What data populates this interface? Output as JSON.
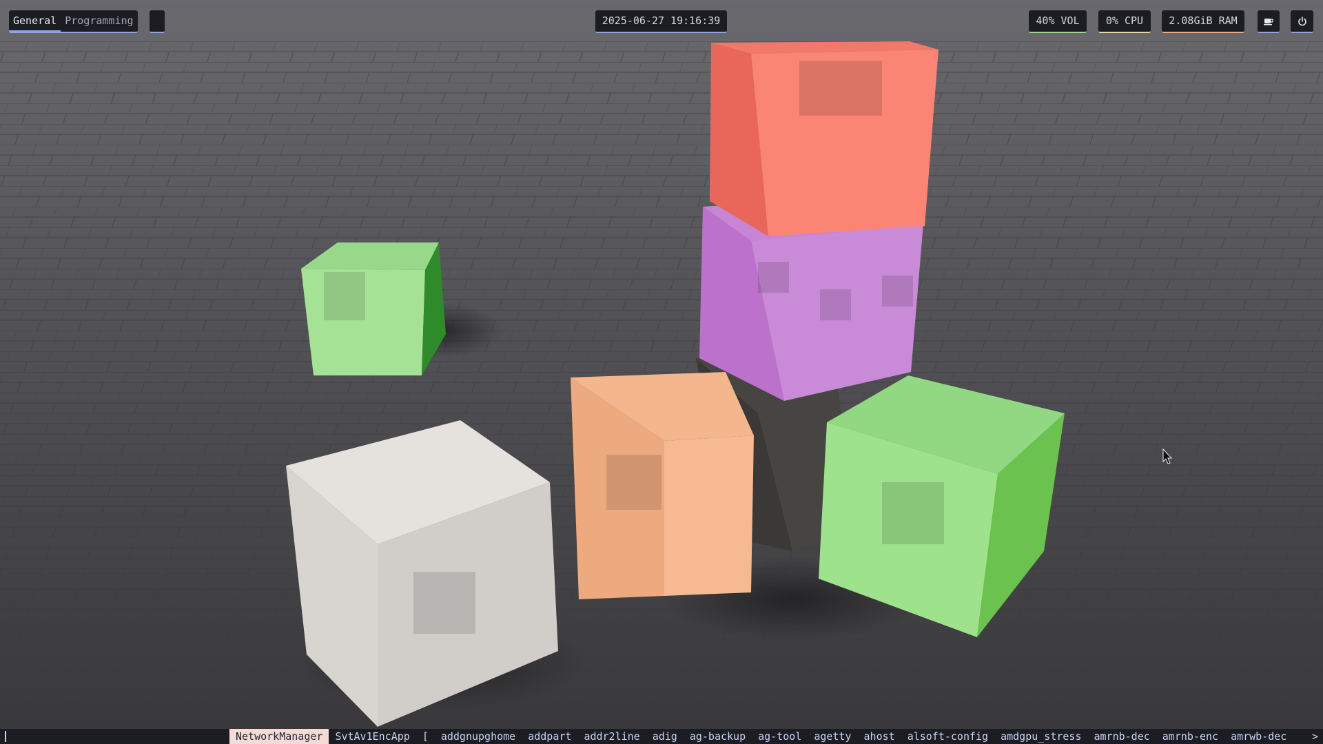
{
  "workspaces": [
    {
      "label": "General",
      "active": true
    },
    {
      "label": "Programming",
      "active": false
    }
  ],
  "clock": {
    "text": "2025-06-27 19:16:39"
  },
  "status": {
    "volume": "40% VOL",
    "cpu": "0% CPU",
    "ram": "2.08GiB RAM"
  },
  "icons": {
    "caffeine": "coffee-icon",
    "power": "power-icon",
    "pointer": "mouse-pointer-icon"
  },
  "launcher": {
    "input_value": "",
    "items": [
      "NetworkManager",
      "SvtAv1EncApp",
      "[",
      "addgnupghome",
      "addpart",
      "addr2line",
      "adig",
      "ag-backup",
      "ag-tool",
      "agetty",
      "ahost",
      "alsoft-config",
      "amdgpu_stress",
      "amrnb-dec",
      "amrnb-enc",
      "amrwb-dec"
    ],
    "selected_index": 0,
    "more": ">"
  },
  "colors": {
    "bar_bg": "#1c1d23",
    "accent_blue": "#8aa7e8",
    "accent_green": "#9fd88f",
    "accent_yellow": "#eed49f",
    "accent_orange": "#f5a97f",
    "selection_bg": "#f4dbd6"
  }
}
